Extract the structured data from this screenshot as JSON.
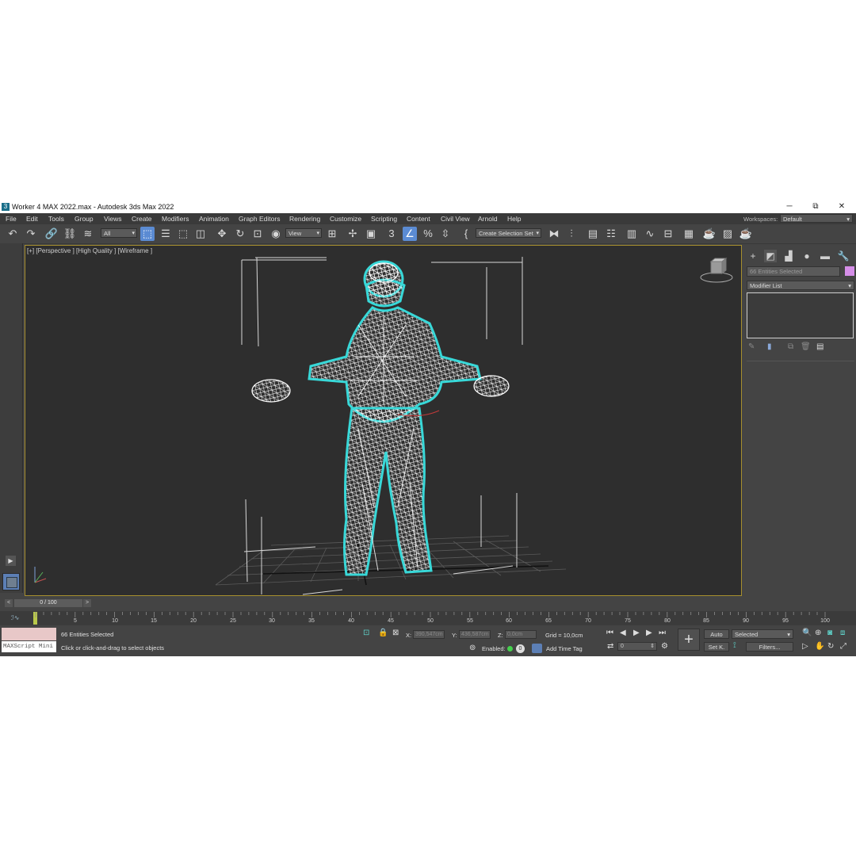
{
  "window": {
    "app_icon": "3",
    "title": "Worker 4 MAX 2022.max - Autodesk 3ds Max 2022",
    "minimize": "─",
    "restore": "⧉",
    "close": "✕"
  },
  "menu": [
    "File",
    "Edit",
    "Tools",
    "Group",
    "Views",
    "Create",
    "Modifiers",
    "Animation",
    "Graph Editors",
    "Rendering",
    "Customize",
    "Scripting",
    "Content",
    "Civil View",
    "Arnold",
    "Help"
  ],
  "workspaces": {
    "label": "Workspaces:",
    "value": "Default"
  },
  "toolbar": {
    "filter_value": "All",
    "coord_system": "View",
    "selection_set": "Create Selection Set",
    "icons": [
      "undo-icon",
      "redo-icon",
      "link-icon",
      "unlink-icon",
      "bind-space-warp-icon",
      "select-object-icon",
      "select-by-name-icon",
      "rect-selection-icon",
      "window-crossing-icon",
      "move-icon",
      "rotate-icon",
      "scale-icon",
      "placement-icon",
      "pivot-icon",
      "select-manipulate-icon",
      "keyboard-shortcut-icon",
      "snaps-icon",
      "angle-snap-icon",
      "percent-snap-icon",
      "spinner-snap-icon",
      "named-selection-icon",
      "mirror-icon",
      "align-icon",
      "scene-explorer-icon",
      "layer-explorer-icon",
      "ribbon-icon",
      "curve-editor-icon",
      "schematic-view-icon",
      "material-editor-icon",
      "render-setup-icon",
      "rendered-frame-icon",
      "render-icon"
    ]
  },
  "viewport": {
    "label": "[+] [Perspective ] [High Quality ] [Wireframe ]",
    "accent_border": "#a78f2e",
    "selection_color": "#38d8d8"
  },
  "command_panel": {
    "name_field": "66 Entities Selected",
    "object_color": "#d58ee8",
    "modifier_list": "Modifier List"
  },
  "time_slider": {
    "left": "<",
    "value": "0 / 100",
    "right": ">"
  },
  "trackbar": {
    "ticks": [
      "5",
      "10",
      "15",
      "20",
      "25",
      "30",
      "35",
      "40",
      "45",
      "50",
      "55",
      "60",
      "65",
      "70",
      "75",
      "80",
      "85",
      "90",
      "95",
      "100"
    ]
  },
  "status": {
    "maxscript": "MAXScript Mini",
    "selection": "66 Entities Selected",
    "prompt": "Click or click-and-drag to select objects",
    "x_label": "X:",
    "x_value": "390,547cm",
    "y_label": "Y:",
    "y_value": "436,587cm",
    "z_label": "Z:",
    "z_value": "0,0cm",
    "grid": "Grid = 10,0cm",
    "enabled_label": "Enabled:",
    "add_time_tag": "Add Time Tag",
    "auto": "Auto",
    "set_key": "Set K.",
    "key_mode": "Selected",
    "filters": "Filters...",
    "frame": "0"
  }
}
